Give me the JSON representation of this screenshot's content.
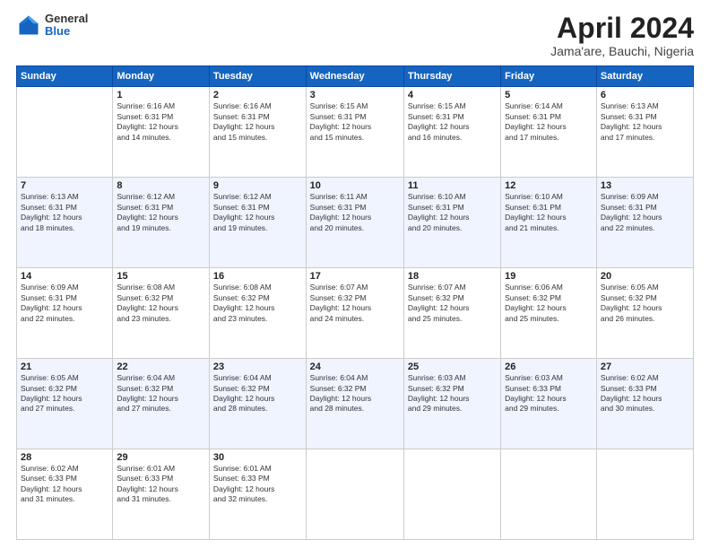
{
  "header": {
    "logo_general": "General",
    "logo_blue": "Blue",
    "title": "April 2024",
    "location": "Jama'are, Bauchi, Nigeria"
  },
  "days_of_week": [
    "Sunday",
    "Monday",
    "Tuesday",
    "Wednesday",
    "Thursday",
    "Friday",
    "Saturday"
  ],
  "weeks": [
    [
      {
        "num": "",
        "detail": ""
      },
      {
        "num": "1",
        "detail": "Sunrise: 6:16 AM\nSunset: 6:31 PM\nDaylight: 12 hours\nand 14 minutes."
      },
      {
        "num": "2",
        "detail": "Sunrise: 6:16 AM\nSunset: 6:31 PM\nDaylight: 12 hours\nand 15 minutes."
      },
      {
        "num": "3",
        "detail": "Sunrise: 6:15 AM\nSunset: 6:31 PM\nDaylight: 12 hours\nand 15 minutes."
      },
      {
        "num": "4",
        "detail": "Sunrise: 6:15 AM\nSunset: 6:31 PM\nDaylight: 12 hours\nand 16 minutes."
      },
      {
        "num": "5",
        "detail": "Sunrise: 6:14 AM\nSunset: 6:31 PM\nDaylight: 12 hours\nand 17 minutes."
      },
      {
        "num": "6",
        "detail": "Sunrise: 6:13 AM\nSunset: 6:31 PM\nDaylight: 12 hours\nand 17 minutes."
      }
    ],
    [
      {
        "num": "7",
        "detail": "Sunrise: 6:13 AM\nSunset: 6:31 PM\nDaylight: 12 hours\nand 18 minutes."
      },
      {
        "num": "8",
        "detail": "Sunrise: 6:12 AM\nSunset: 6:31 PM\nDaylight: 12 hours\nand 19 minutes."
      },
      {
        "num": "9",
        "detail": "Sunrise: 6:12 AM\nSunset: 6:31 PM\nDaylight: 12 hours\nand 19 minutes."
      },
      {
        "num": "10",
        "detail": "Sunrise: 6:11 AM\nSunset: 6:31 PM\nDaylight: 12 hours\nand 20 minutes."
      },
      {
        "num": "11",
        "detail": "Sunrise: 6:10 AM\nSunset: 6:31 PM\nDaylight: 12 hours\nand 20 minutes."
      },
      {
        "num": "12",
        "detail": "Sunrise: 6:10 AM\nSunset: 6:31 PM\nDaylight: 12 hours\nand 21 minutes."
      },
      {
        "num": "13",
        "detail": "Sunrise: 6:09 AM\nSunset: 6:31 PM\nDaylight: 12 hours\nand 22 minutes."
      }
    ],
    [
      {
        "num": "14",
        "detail": "Sunrise: 6:09 AM\nSunset: 6:31 PM\nDaylight: 12 hours\nand 22 minutes."
      },
      {
        "num": "15",
        "detail": "Sunrise: 6:08 AM\nSunset: 6:32 PM\nDaylight: 12 hours\nand 23 minutes."
      },
      {
        "num": "16",
        "detail": "Sunrise: 6:08 AM\nSunset: 6:32 PM\nDaylight: 12 hours\nand 23 minutes."
      },
      {
        "num": "17",
        "detail": "Sunrise: 6:07 AM\nSunset: 6:32 PM\nDaylight: 12 hours\nand 24 minutes."
      },
      {
        "num": "18",
        "detail": "Sunrise: 6:07 AM\nSunset: 6:32 PM\nDaylight: 12 hours\nand 25 minutes."
      },
      {
        "num": "19",
        "detail": "Sunrise: 6:06 AM\nSunset: 6:32 PM\nDaylight: 12 hours\nand 25 minutes."
      },
      {
        "num": "20",
        "detail": "Sunrise: 6:05 AM\nSunset: 6:32 PM\nDaylight: 12 hours\nand 26 minutes."
      }
    ],
    [
      {
        "num": "21",
        "detail": "Sunrise: 6:05 AM\nSunset: 6:32 PM\nDaylight: 12 hours\nand 27 minutes."
      },
      {
        "num": "22",
        "detail": "Sunrise: 6:04 AM\nSunset: 6:32 PM\nDaylight: 12 hours\nand 27 minutes."
      },
      {
        "num": "23",
        "detail": "Sunrise: 6:04 AM\nSunset: 6:32 PM\nDaylight: 12 hours\nand 28 minutes."
      },
      {
        "num": "24",
        "detail": "Sunrise: 6:04 AM\nSunset: 6:32 PM\nDaylight: 12 hours\nand 28 minutes."
      },
      {
        "num": "25",
        "detail": "Sunrise: 6:03 AM\nSunset: 6:32 PM\nDaylight: 12 hours\nand 29 minutes."
      },
      {
        "num": "26",
        "detail": "Sunrise: 6:03 AM\nSunset: 6:33 PM\nDaylight: 12 hours\nand 29 minutes."
      },
      {
        "num": "27",
        "detail": "Sunrise: 6:02 AM\nSunset: 6:33 PM\nDaylight: 12 hours\nand 30 minutes."
      }
    ],
    [
      {
        "num": "28",
        "detail": "Sunrise: 6:02 AM\nSunset: 6:33 PM\nDaylight: 12 hours\nand 31 minutes."
      },
      {
        "num": "29",
        "detail": "Sunrise: 6:01 AM\nSunset: 6:33 PM\nDaylight: 12 hours\nand 31 minutes."
      },
      {
        "num": "30",
        "detail": "Sunrise: 6:01 AM\nSunset: 6:33 PM\nDaylight: 12 hours\nand 32 minutes."
      },
      {
        "num": "",
        "detail": ""
      },
      {
        "num": "",
        "detail": ""
      },
      {
        "num": "",
        "detail": ""
      },
      {
        "num": "",
        "detail": ""
      }
    ]
  ]
}
